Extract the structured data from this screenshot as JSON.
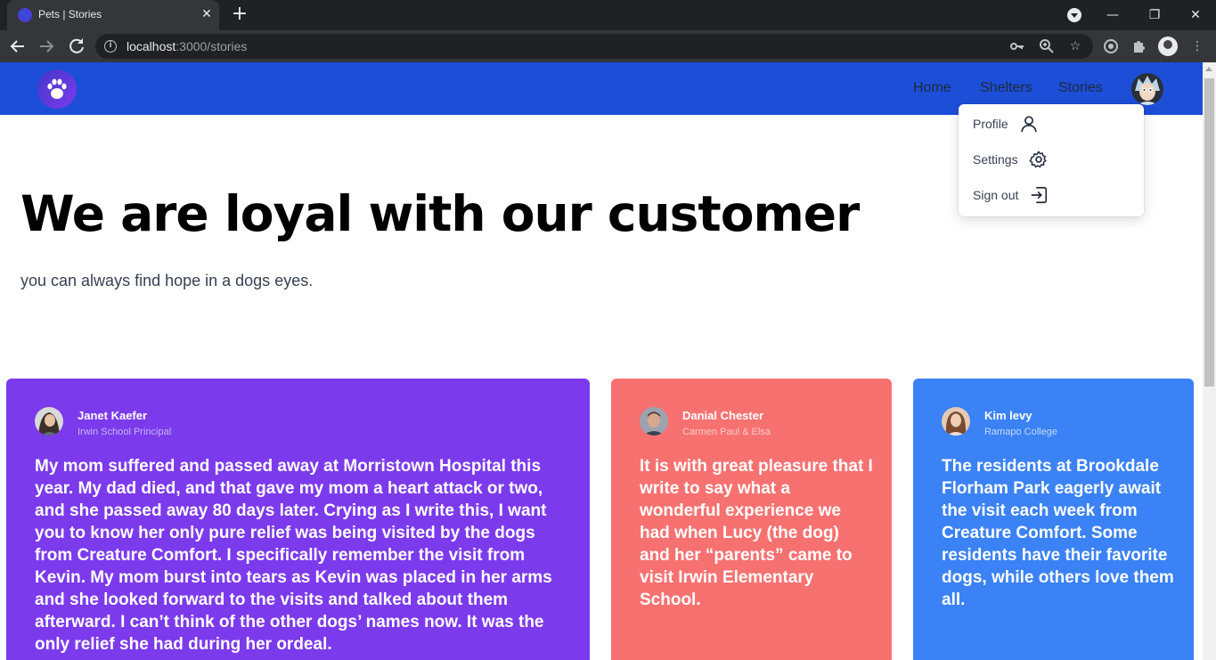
{
  "browser": {
    "tab_title": "Pets | Stories",
    "url_host": "localhost",
    "url_path": ":3000/stories"
  },
  "navbar": {
    "links": [
      "Home",
      "Shelters",
      "Stories"
    ]
  },
  "user_menu": {
    "items": [
      {
        "label": "Profile",
        "icon": "user-icon"
      },
      {
        "label": "Settings",
        "icon": "gear-icon"
      },
      {
        "label": "Sign out",
        "icon": "sign-out-icon"
      }
    ]
  },
  "hero": {
    "title": "We are loyal with our customer",
    "subtitle": "you can always find hope in a dogs eyes."
  },
  "stories": [
    {
      "name": "Janet Kaefer",
      "role": "Irwin School Principal",
      "quote": "My mom suffered and passed away at Morristown Hospital this year. My dad died, and that gave my mom a heart attack or two, and she passed away 80 days later. Crying as I write this, I want you to know her only pure relief was being visited by the dogs from Creature Comfort. I specifically remember the visit from Kevin. My mom burst into tears as Kevin was placed in her arms and she looked forward to the visits and talked about them afterward. I can’t think of the other dogs’ names now. It was the only relief she had during her ordeal.",
      "color": "#7c3aed"
    },
    {
      "name": "Danial Chester",
      "role": "Carmen Paul & Elsa",
      "quote": "It is with great pleasure that I write to say what a wonderful experience we had when Lucy (the dog) and her “parents” came to visit Irwin Elementary School.",
      "color": "#f87171"
    },
    {
      "name": "Kim levy",
      "role": "Ramapo College",
      "quote": "The residents at Brookdale Florham Park eagerly await the visit each week from Creature Comfort. Some residents have their favorite dogs, while others love them all.",
      "color": "#3b82f6"
    }
  ],
  "colors": {
    "navbar": "#1d4ed8",
    "card_purple": "#7c3aed",
    "card_red": "#f87171",
    "card_blue": "#3b82f6"
  }
}
